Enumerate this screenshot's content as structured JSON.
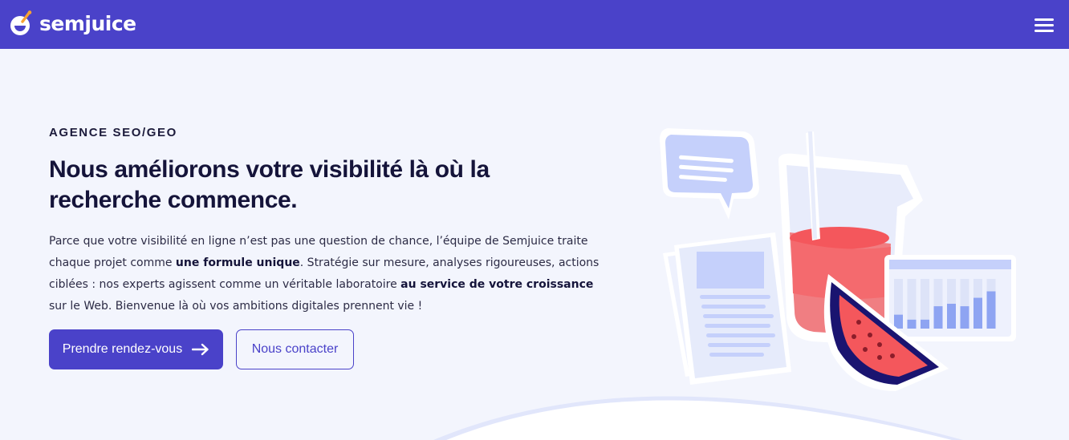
{
  "header": {
    "brand": "semjuice",
    "logo_icon": "juice-glass-logo-icon",
    "menu_icon": "hamburger-menu-icon",
    "background": "#4a42c9"
  },
  "hero": {
    "eyebrow": "AGENCE SEO/GEO",
    "headline": "Nous améliorons votre visibilité là où la recherche commence.",
    "paragraph": [
      {
        "text": "Parce que votre visibilité en ligne n’est pas une question de chance, l’équipe de Semjuice traite chaque projet comme ",
        "bold": false
      },
      {
        "text": "une formule unique",
        "bold": true
      },
      {
        "text": ". Stratégie sur mesure, analyses rigoureuses, actions ciblées : nos experts agissent comme un véritable laboratoire ",
        "bold": false
      },
      {
        "text": "au service de votre croissance",
        "bold": true
      },
      {
        "text": " sur le Web. Bienvenue là où vos ambitions digitales prennent vie !",
        "bold": false
      }
    ],
    "primary_button": "Prendre rendez-vous",
    "primary_button_icon": "arrow-right-icon",
    "secondary_button": "Nous contacter"
  },
  "illustration": {
    "elements": [
      "speech-bubble-icon",
      "document-icon",
      "juice-glass-icon",
      "bar-chart-icon",
      "watermelon-slice-icon"
    ],
    "chart_bars": [
      0.28,
      0.18,
      0.18,
      0.45,
      0.5,
      0.45,
      0.62,
      0.75
    ],
    "colors": {
      "accent": "#4a42c9",
      "juice": "#f46a6e",
      "paper": "#e6ebfb",
      "bars": "#8ea4f2",
      "rind": "#1a1470"
    }
  },
  "colors": {
    "background": "#f3f5fd",
    "text": "#15143a"
  }
}
